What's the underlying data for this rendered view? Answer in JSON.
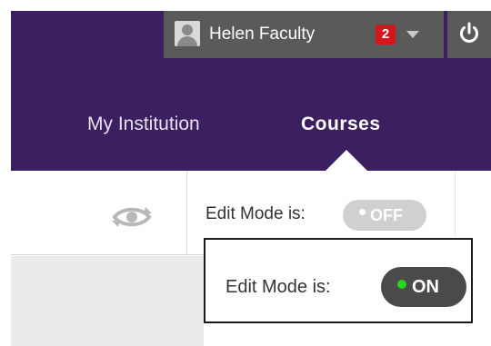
{
  "user_menu": {
    "user_name": "Helen Faculty",
    "notification_count": "2",
    "avatar_icon": "user-avatar-icon",
    "dropdown_icon": "caret-down-icon",
    "logout_icon": "power-icon"
  },
  "nav": {
    "tabs": [
      {
        "label": "My Institution"
      },
      {
        "label": "Courses",
        "active": true
      }
    ]
  },
  "toolbar": {
    "view_icon": "eye-refresh-icon",
    "edit_mode_label": "Edit Mode is:",
    "edit_mode_value": "OFF"
  },
  "callout": {
    "edit_mode_label": "Edit Mode is:",
    "edit_mode_value": "ON"
  },
  "colors": {
    "header_bg": "#3c1f60",
    "user_bar_bg": "#5a5a5a",
    "badge": "#d8151b",
    "toggle_on_dot": "#22d61a",
    "toggle_off_bg": "#d0d0d0",
    "toggle_on_bg": "#4a4a4a"
  }
}
